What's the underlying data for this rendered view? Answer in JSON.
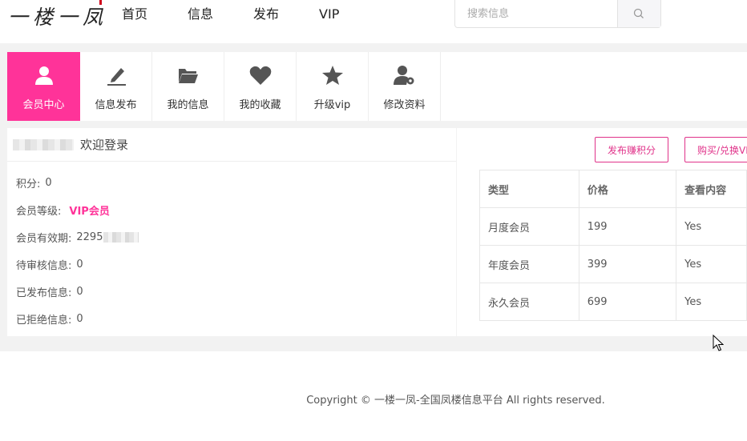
{
  "header": {
    "logo_text": "一楼一凤",
    "nav": [
      "首页",
      "信息",
      "发布",
      "VIP"
    ],
    "search_placeholder": "搜索信息"
  },
  "tabs": [
    {
      "label": "会员中心",
      "icon": "user-icon",
      "active": true
    },
    {
      "label": "信息发布",
      "icon": "pencil-icon",
      "active": false
    },
    {
      "label": "我的信息",
      "icon": "folder-icon",
      "active": false
    },
    {
      "label": "我的收藏",
      "icon": "heart-icon",
      "active": false
    },
    {
      "label": "升级vip",
      "icon": "star-icon",
      "active": false
    },
    {
      "label": "修改资料",
      "icon": "user-gear-icon",
      "active": false
    }
  ],
  "profile": {
    "welcome": "欢迎登录",
    "rows": [
      {
        "label": "积分:",
        "value": "0"
      },
      {
        "label": "会员等级:",
        "value": "VIP会员"
      },
      {
        "label": "会员有效期:",
        "value": "2295"
      },
      {
        "label": "待审核信息:",
        "value": "0"
      },
      {
        "label": "已发布信息:",
        "value": "0"
      },
      {
        "label": "已拒绝信息:",
        "value": "0"
      }
    ]
  },
  "actions": {
    "publish_points": "发布赚积分",
    "buy_vip": "购买/兑换VIP"
  },
  "vip_table": {
    "headers": [
      "类型",
      "价格",
      "查看内容"
    ],
    "rows": [
      [
        "月度会员",
        "199",
        "Yes"
      ],
      [
        "年度会员",
        "399",
        "Yes"
      ],
      [
        "永久会员",
        "699",
        "Yes"
      ]
    ]
  },
  "footer": {
    "copyright": "Copyright © 一楼一凤-全国凤楼信息平台 All rights reserved."
  },
  "colors": {
    "accent": "#ff3399",
    "band": "#f2f2f2"
  }
}
